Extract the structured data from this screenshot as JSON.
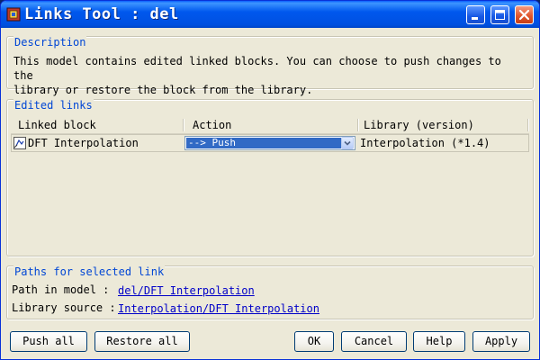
{
  "window": {
    "title": "Links Tool : del",
    "controls": {
      "minimize": "minimize",
      "maximize": "maximize",
      "close": "close"
    }
  },
  "description": {
    "heading": "Description",
    "text": "This model contains edited linked blocks. You can choose to push changes to the\nlibrary or restore the block from the library."
  },
  "edited_links": {
    "heading": "Edited links",
    "columns": [
      "Linked block",
      "Action",
      "Library (version)"
    ],
    "rows": [
      {
        "block": "DFT Interpolation",
        "action": "--> Push",
        "library": "Interpolation (*1.4)"
      }
    ]
  },
  "paths": {
    "heading": "Paths for selected link",
    "path_in_model_label": "Path in model  :",
    "path_in_model_value": "del/DFT Interpolation",
    "library_source_label": "Library source :",
    "library_source_value": "Interpolation/DFT Interpolation"
  },
  "buttons": {
    "push_all": "Push all",
    "restore_all": "Restore all",
    "ok": "OK",
    "cancel": "Cancel",
    "help": "Help",
    "apply": "Apply"
  },
  "colors": {
    "titlebar": "#0058ee",
    "section_title": "#0046d5",
    "link": "#0000c8",
    "selection": "#316ac5",
    "face": "#ece9d8"
  },
  "icons": [
    "simulink-app-icon",
    "linked-block-icon",
    "dropdown-chevron-icon",
    "minimize-icon",
    "maximize-icon",
    "close-icon"
  ]
}
